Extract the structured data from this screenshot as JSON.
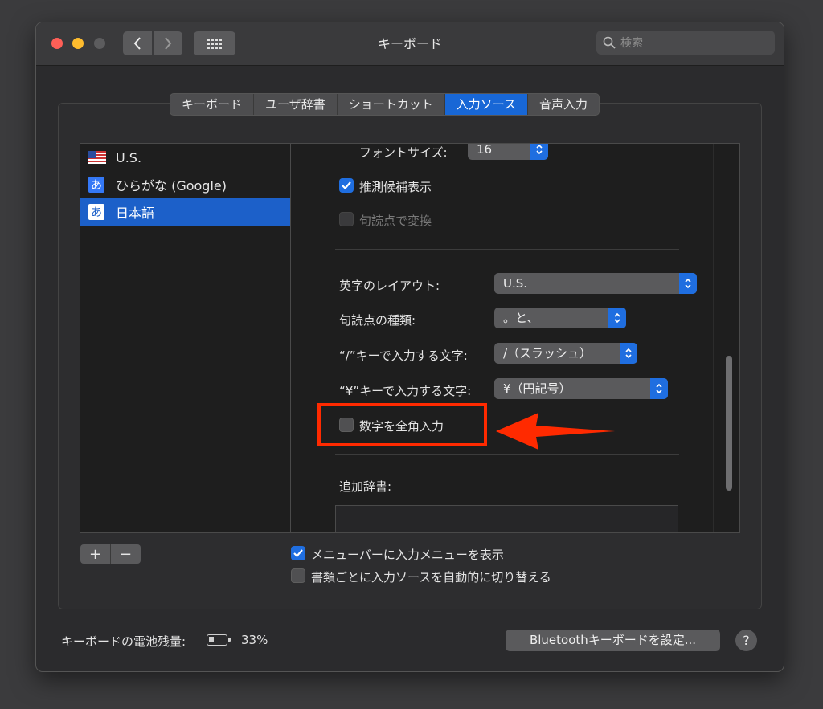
{
  "window": {
    "title": "キーボード"
  },
  "search": {
    "placeholder": "検索"
  },
  "tabs": [
    {
      "label": "キーボード",
      "active": false
    },
    {
      "label": "ユーザ辞書",
      "active": false
    },
    {
      "label": "ショートカット",
      "active": false
    },
    {
      "label": "入力ソース",
      "active": true
    },
    {
      "label": "音声入力",
      "active": false
    }
  ],
  "sources": [
    {
      "label": "U.S.",
      "icon": "us-flag-icon"
    },
    {
      "label": "ひらがな (Google)",
      "icon": "kana-icon",
      "glyph": "あ"
    },
    {
      "label": "日本語",
      "icon": "kana-icon",
      "glyph": "あ",
      "selected": true
    }
  ],
  "settings": {
    "font_size_label": "フォントサイズ:",
    "font_size_value": "16",
    "predict_label": "推測候補表示",
    "predict_checked": true,
    "punct_convert_label": "句読点で変換",
    "punct_convert_checked": false,
    "alpha_layout_label": "英字のレイアウト:",
    "alpha_layout_value": "U.S.",
    "punct_type_label": "句読点の種類:",
    "punct_type_value": "。と、",
    "slash_key_label": "“/”キーで入力する文字:",
    "slash_key_value": "/（スラッシュ）",
    "yen_key_label": "“¥”キーで入力する文字:",
    "yen_key_value": "¥（円記号）",
    "fullwidth_num_label": "数字を全角入力",
    "fullwidth_num_checked": false,
    "extra_dict_label": "追加辞書:"
  },
  "list_buttons": {
    "add": "+",
    "remove": "−"
  },
  "options": {
    "show_menu_label": "メニューバーに入力メニューを表示",
    "show_menu_checked": true,
    "auto_switch_label": "書類ごとに入力ソースを自動的に切り替える",
    "auto_switch_checked": false
  },
  "footer": {
    "battery_label": "キーボードの電池残量:",
    "battery_percent": "33%",
    "battery_level": 0.33,
    "bluetooth_button": "Bluetoothキーボードを設定...",
    "help": "?"
  },
  "colors": {
    "accent": "#1f6ee0",
    "highlight": "#ff2a00"
  }
}
